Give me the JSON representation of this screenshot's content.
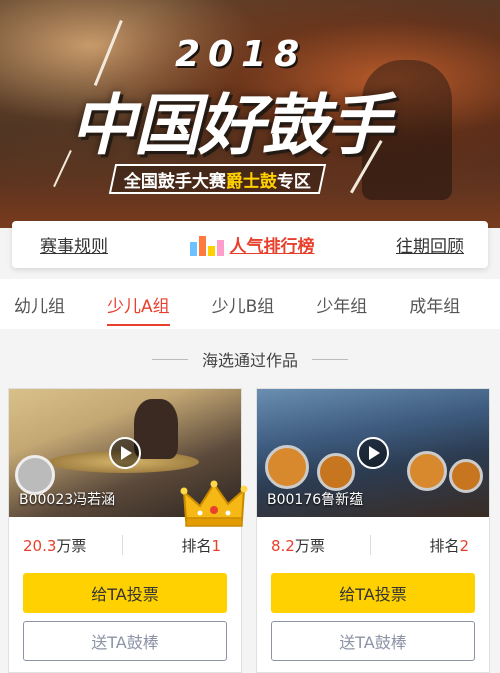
{
  "banner": {
    "year": "2018",
    "title": "中国好鼓手",
    "subtitle_pre": "全国鼓手大赛",
    "subtitle_highlight": "爵士鼓",
    "subtitle_post": "专区"
  },
  "nav": {
    "rules": "赛事规则",
    "ranking": "人气排行榜",
    "history": "往期回顾"
  },
  "tabs": [
    {
      "label": "幼儿组",
      "active": false
    },
    {
      "label": "少儿A组",
      "active": true
    },
    {
      "label": "少儿B组",
      "active": false
    },
    {
      "label": "少年组",
      "active": false
    },
    {
      "label": "成年组",
      "active": false
    }
  ],
  "section_title": "海选通过作品",
  "entries": [
    {
      "caption": "B00023冯若涵",
      "votes": "20.3",
      "votes_unit": "万票",
      "rank_label": "排名",
      "rank": "1",
      "vote_button": "给TA投票",
      "gift_button": "送TA鼓棒"
    },
    {
      "caption": "B00176鲁新蕴",
      "votes": "8.2",
      "votes_unit": "万票",
      "rank_label": "排名",
      "rank": "2",
      "vote_button": "给TA投票",
      "gift_button": "送TA鼓棒"
    }
  ],
  "colors": {
    "accent": "#e8402d",
    "vote_button": "#ffd100",
    "gift_border": "#8d94a6"
  },
  "icons": {
    "play": "play-icon",
    "ranking": "bar-chart-icon",
    "first_place": "crown-icon"
  }
}
